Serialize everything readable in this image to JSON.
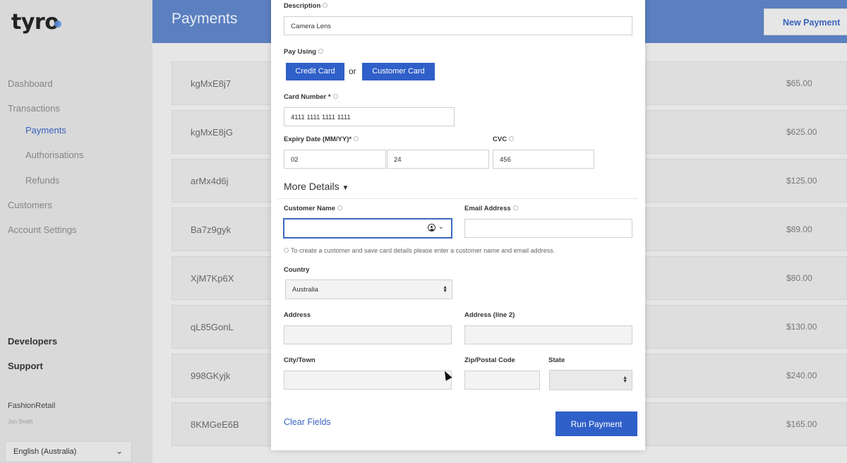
{
  "app": {
    "logo": "tyro"
  },
  "sidebar": {
    "nav": [
      "Dashboard",
      "Transactions",
      "Payments",
      "Authorisations",
      "Refunds",
      "Customers",
      "Account Settings"
    ],
    "developers": "Developers",
    "support": "Support",
    "merchant": "FashionRetail",
    "user": "Jon Smith",
    "language": "English (Australia)"
  },
  "header": {
    "title": "Payments",
    "new_payment": "New Payment"
  },
  "table": {
    "rows": [
      {
        "id": "kgMxE8j7",
        "amount": "$65.00"
      },
      {
        "id": "kgMxE8jG",
        "amount": "$625.00"
      },
      {
        "id": "arMx4d6j",
        "amount": "$125.00"
      },
      {
        "id": "Ba7z9gyk",
        "amount": "$89.00"
      },
      {
        "id": "XjM7Kp6X",
        "amount": "$80.00"
      },
      {
        "id": "qL85GonL",
        "amount": "$130.00"
      },
      {
        "id": "998GKyjk",
        "amount": "$240.00"
      },
      {
        "id": "8KMGeE6B",
        "amount": "$165.00"
      }
    ]
  },
  "modal": {
    "description_label": "Description",
    "description_value": "Camera Lens",
    "pay_using_label": "Pay Using",
    "credit_card": "Credit Card",
    "or": "or",
    "customer_card": "Customer Card",
    "card_number_label": "Card Number *",
    "card_number_value": "4111 1111 1111 1111",
    "expiry_label": "Expiry Date (MM/YY)*",
    "expiry_month": "02",
    "expiry_year": "24",
    "cvc_label": "CVC",
    "cvc_value": "456",
    "more_details": "More Details",
    "customer_name_label": "Customer Name",
    "customer_name_value": "",
    "email_label": "Email Address",
    "email_value": "",
    "hint": "To create a customer and save card details please enter a customer name and email address.",
    "country_label": "Country",
    "country_value": "Australia",
    "address_label": "Address",
    "address2_label": "Address (line 2)",
    "city_label": "City/Town",
    "zip_label": "Zip/Postal Code",
    "state_label": "State",
    "clear_fields": "Clear Fields",
    "run_payment": "Run Payment"
  },
  "colors": {
    "accent": "#2f5fc8",
    "header": "#5b7fbf"
  }
}
